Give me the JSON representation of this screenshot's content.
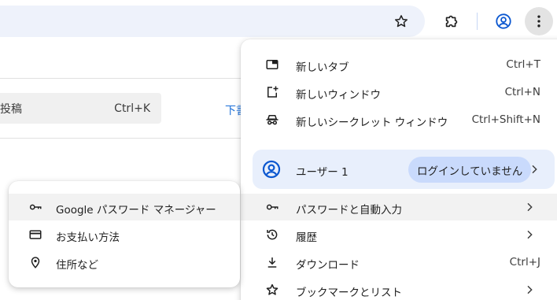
{
  "toolbar": {
    "bookmark_icon": "star-icon",
    "extensions_icon": "puzzle-icon",
    "profile_icon": "account-circle-icon",
    "menu_icon": "three-dot-vertical-icon"
  },
  "page": {
    "post_label": "投稿",
    "post_shortcut": "Ctrl+K",
    "download_link": "下書"
  },
  "main_menu": {
    "new_tab": {
      "label": "新しいタブ",
      "shortcut": "Ctrl+T",
      "icon": "new-tab-icon"
    },
    "new_window": {
      "label": "新しいウィンドウ",
      "shortcut": "Ctrl+N",
      "icon": "new-window-icon"
    },
    "incognito": {
      "label": "新しいシークレット ウィンドウ",
      "shortcut": "Ctrl+Shift+N",
      "icon": "incognito-icon"
    },
    "profile": {
      "name": "ユーザー 1",
      "status": "ログインしていません",
      "icon": "account-circle-icon"
    },
    "passwords": {
      "label": "パスワードと自動入力",
      "icon": "key-icon"
    },
    "history": {
      "label": "履歴",
      "icon": "history-icon"
    },
    "downloads": {
      "label": "ダウンロード",
      "shortcut": "Ctrl+J",
      "icon": "download-icon"
    },
    "bookmarks": {
      "label": "ブックマークとリスト",
      "icon": "star-icon"
    }
  },
  "sub_menu": {
    "password_manager": {
      "label": "Google パスワード マネージャー",
      "icon": "key-icon"
    },
    "payment_methods": {
      "label": "お支払い方法",
      "icon": "credit-card-icon"
    },
    "addresses": {
      "label": "住所など",
      "icon": "location-pin-icon"
    }
  },
  "colors": {
    "accent": "#0b57d0",
    "profile_card_bg": "#e8effc",
    "signin_pill_bg": "#c9dafc",
    "hover_bg": "#f2f2f2",
    "link": "#1a6ed8"
  }
}
